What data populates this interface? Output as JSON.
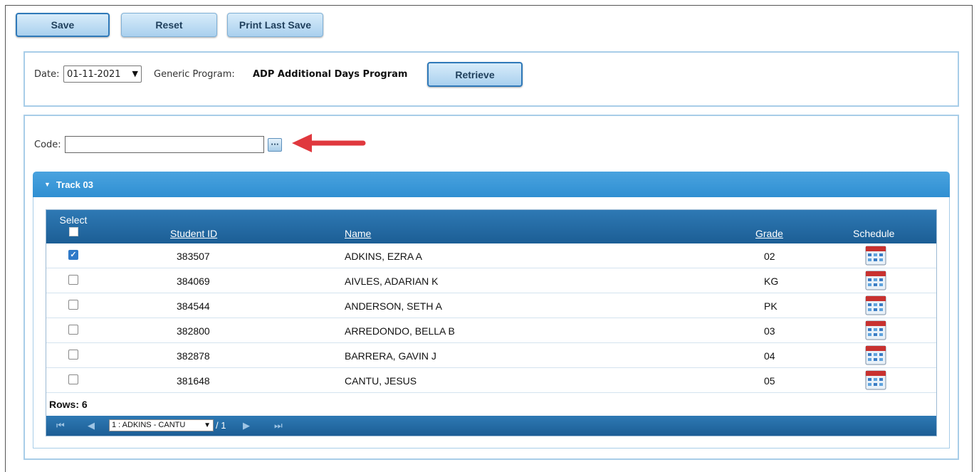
{
  "toolbar": {
    "save_label": "Save",
    "reset_label": "Reset",
    "print_label": "Print Last Save"
  },
  "filter": {
    "date_label": "Date:",
    "date_value": "01-11-2021",
    "program_label": "Generic Program:",
    "program_value": "ADP Additional Days Program",
    "retrieve_label": "Retrieve"
  },
  "code": {
    "label": "Code:",
    "value": "",
    "lookup_label": "···"
  },
  "track": {
    "title": "Track 03"
  },
  "grid": {
    "headers": {
      "select": "Select",
      "student_id": "Student ID",
      "name": "Name",
      "grade": "Grade",
      "schedule": "Schedule"
    },
    "rows": [
      {
        "checked": true,
        "student_id": "383507",
        "name": "ADKINS, EZRA A",
        "grade": "02"
      },
      {
        "checked": false,
        "student_id": "384069",
        "name": "AIVLES, ADARIAN K",
        "grade": "KG"
      },
      {
        "checked": false,
        "student_id": "384544",
        "name": "ANDERSON, SETH A",
        "grade": "PK"
      },
      {
        "checked": false,
        "student_id": "382800",
        "name": "ARREDONDO, BELLA B",
        "grade": "03"
      },
      {
        "checked": false,
        "student_id": "382878",
        "name": "BARRERA, GAVIN J",
        "grade": "04"
      },
      {
        "checked": false,
        "student_id": "381648",
        "name": "CANTU, JESUS",
        "grade": "05"
      }
    ],
    "rows_label": "Rows: 6",
    "pager": {
      "page_select": "1 : ADKINS - CANTU",
      "page_total": "/ 1"
    }
  },
  "colors": {
    "accent": "#2f8fd2",
    "header": "#1c5e95",
    "button": "#a9d0ee",
    "arrow": "#e0383e"
  }
}
